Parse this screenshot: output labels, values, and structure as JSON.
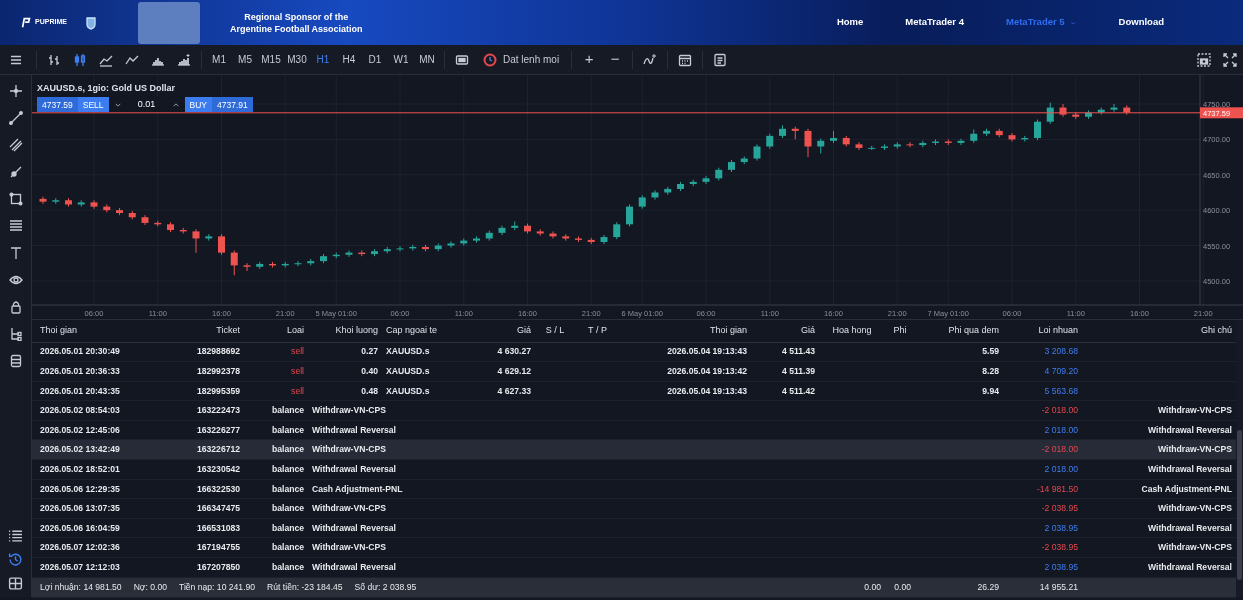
{
  "banner": {
    "logo": "PUPRIME",
    "sponsor_lines": [
      "Regional Sponsor of the",
      "Argentine Football Association"
    ],
    "nav": [
      {
        "label": "Home",
        "selected": false,
        "dropdown": false
      },
      {
        "label": "MetaTrader 4",
        "selected": false,
        "dropdown": false
      },
      {
        "label": "MetaTrader 5",
        "selected": true,
        "dropdown": true
      },
      {
        "label": "Download",
        "selected": false,
        "dropdown": false
      }
    ]
  },
  "toolbar": {
    "chart_types": [
      {
        "kind": "bars",
        "selected": false
      },
      {
        "kind": "candles",
        "selected": true
      },
      {
        "kind": "area",
        "selected": false
      },
      {
        "kind": "line",
        "selected": false
      },
      {
        "kind": "histogram",
        "selected": false
      },
      {
        "kind": "baseline",
        "selected": false
      }
    ],
    "timeframes": [
      {
        "label": "M1",
        "selected": false
      },
      {
        "label": "M5",
        "selected": false
      },
      {
        "label": "M15",
        "selected": false
      },
      {
        "label": "M30",
        "selected": false
      },
      {
        "label": "H1",
        "selected": true
      },
      {
        "label": "H4",
        "selected": false
      },
      {
        "label": "D1",
        "selected": false
      },
      {
        "label": "W1",
        "selected": false
      },
      {
        "label": "MN",
        "selected": false
      }
    ],
    "order_button": "Dat lenh moi",
    "zoom_in": "+",
    "zoom_out": "−"
  },
  "chart": {
    "title": "XAUUSD.s, 1gio: Gold US Dollar",
    "sell_price": "4737.59",
    "sell_label": "SELL",
    "volume": "0.01",
    "buy_label": "BUY",
    "buy_price": "4737.91",
    "chart_data": {
      "type": "candlestick",
      "categories": [
        null,
        null,
        null,
        null,
        "06:00",
        null,
        null,
        null,
        null,
        "11:00",
        null,
        null,
        null,
        null,
        "16:00",
        null,
        null,
        null,
        null,
        "21:00",
        null,
        null,
        null,
        "5 May 01:00",
        null,
        null,
        null,
        null,
        "06:00",
        null,
        null,
        null,
        null,
        "11:00",
        null,
        null,
        null,
        null,
        "16:00",
        null,
        null,
        null,
        null,
        "21:00",
        null,
        null,
        null,
        "6 May 01:00",
        null,
        null,
        null,
        null,
        "06:00",
        null,
        null,
        null,
        null,
        "11:00",
        null,
        null,
        null,
        null,
        "16:00",
        null,
        null,
        null,
        null,
        "21:00",
        null,
        null,
        null,
        "7 May 01:00",
        null,
        null,
        null,
        null,
        "06:00",
        null,
        null,
        null,
        null,
        "11:00",
        null,
        null,
        null,
        null,
        "16:00",
        null,
        null,
        null,
        null,
        "21:00"
      ],
      "ylim": [
        4466,
        4791
      ],
      "grid": true,
      "ref_lines": [
        {
          "axis": "y",
          "value": 4737.59,
          "label": "4737.59",
          "color": "#ef5350"
        }
      ],
      "ohlc": [
        [
          4616,
          4619,
          4609,
          4612
        ],
        [
          4612,
          4617,
          4609,
          4614
        ],
        [
          4614,
          4617,
          4605,
          4608
        ],
        [
          4608,
          4614,
          4605,
          4611
        ],
        [
          4611,
          4614,
          4602,
          4605
        ],
        [
          4605,
          4608,
          4597,
          4600
        ],
        [
          4600,
          4603,
          4593,
          4596
        ],
        [
          4596,
          4599,
          4587,
          4590
        ],
        [
          4590,
          4593,
          4579,
          4582
        ],
        [
          4582,
          4585,
          4577,
          4580
        ],
        [
          4580,
          4583,
          4569,
          4572
        ],
        [
          4572,
          4575,
          4567,
          4570
        ],
        [
          4570,
          4573,
          4540,
          4560
        ],
        [
          4560,
          4566,
          4557,
          4563
        ],
        [
          4563,
          4566,
          4537,
          4540
        ],
        [
          4540,
          4543,
          4508,
          4522
        ],
        [
          4522,
          4525,
          4514,
          4520
        ],
        [
          4520,
          4527,
          4517,
          4524
        ],
        [
          4524,
          4527,
          4519,
          4522
        ],
        [
          4522,
          4527,
          4519,
          4524
        ],
        [
          4524,
          4528,
          4521,
          4525
        ],
        [
          4525,
          4531,
          4522,
          4528
        ],
        [
          4528,
          4538,
          4525,
          4535
        ],
        [
          4535,
          4540,
          4532,
          4537
        ],
        [
          4537,
          4543,
          4534,
          4540
        ],
        [
          4540,
          4543,
          4535,
          4538
        ],
        [
          4538,
          4545,
          4535,
          4542
        ],
        [
          4542,
          4548,
          4539,
          4545
        ],
        [
          4545,
          4549,
          4542,
          4546
        ],
        [
          4546,
          4551,
          4543,
          4548
        ],
        [
          4548,
          4551,
          4542,
          4545
        ],
        [
          4545,
          4553,
          4542,
          4550
        ],
        [
          4550,
          4556,
          4547,
          4553
        ],
        [
          4553,
          4560,
          4550,
          4557
        ],
        [
          4557,
          4563,
          4554,
          4560
        ],
        [
          4560,
          4571,
          4557,
          4568
        ],
        [
          4568,
          4578,
          4565,
          4575
        ],
        [
          4575,
          4584,
          4572,
          4578
        ],
        [
          4578,
          4581,
          4567,
          4570
        ],
        [
          4570,
          4573,
          4564,
          4567
        ],
        [
          4567,
          4570,
          4560,
          4563
        ],
        [
          4563,
          4566,
          4557,
          4560
        ],
        [
          4560,
          4563,
          4555,
          4558
        ],
        [
          4558,
          4561,
          4552,
          4555
        ],
        [
          4555,
          4565,
          4552,
          4562
        ],
        [
          4562,
          4583,
          4559,
          4580
        ],
        [
          4580,
          4608,
          4577,
          4605
        ],
        [
          4605,
          4621,
          4602,
          4618
        ],
        [
          4618,
          4628,
          4615,
          4625
        ],
        [
          4625,
          4633,
          4622,
          4630
        ],
        [
          4630,
          4640,
          4627,
          4637
        ],
        [
          4637,
          4643,
          4634,
          4640
        ],
        [
          4640,
          4648,
          4637,
          4645
        ],
        [
          4645,
          4660,
          4642,
          4657
        ],
        [
          4657,
          4671,
          4654,
          4668
        ],
        [
          4668,
          4676,
          4665,
          4673
        ],
        [
          4673,
          4693,
          4670,
          4690
        ],
        [
          4690,
          4708,
          4687,
          4705
        ],
        [
          4705,
          4720,
          4702,
          4715
        ],
        [
          4715,
          4718,
          4700,
          4712
        ],
        [
          4712,
          4715,
          4675,
          4690
        ],
        [
          4690,
          4701,
          4680,
          4698
        ],
        [
          4698,
          4712,
          4695,
          4702
        ],
        [
          4702,
          4705,
          4690,
          4693
        ],
        [
          4693,
          4696,
          4685,
          4688
        ],
        [
          4688,
          4691,
          4685,
          4688
        ],
        [
          4688,
          4693,
          4685,
          4690
        ],
        [
          4690,
          4696,
          4687,
          4693
        ],
        [
          4693,
          4696,
          4689,
          4692
        ],
        [
          4692,
          4698,
          4689,
          4695
        ],
        [
          4695,
          4700,
          4692,
          4697
        ],
        [
          4697,
          4700,
          4692,
          4695
        ],
        [
          4695,
          4701,
          4692,
          4698
        ],
        [
          4698,
          4714,
          4695,
          4708
        ],
        [
          4708,
          4715,
          4705,
          4712
        ],
        [
          4712,
          4715,
          4703,
          4706
        ],
        [
          4706,
          4709,
          4697,
          4700
        ],
        [
          4700,
          4705,
          4697,
          4702
        ],
        [
          4702,
          4728,
          4699,
          4725
        ],
        [
          4725,
          4752,
          4722,
          4745
        ],
        [
          4745,
          4750,
          4732,
          4735
        ],
        [
          4735,
          4738,
          4729,
          4732
        ],
        [
          4732,
          4741,
          4729,
          4738
        ],
        [
          4738,
          4745,
          4735,
          4742
        ],
        [
          4742,
          4750,
          4739,
          4745
        ],
        [
          4745,
          4748,
          4735,
          4738
        ],
        null,
        null,
        null,
        null,
        null,
        null
      ],
      "yticks": [
        {
          "value": 4750,
          "label": "4750.00"
        },
        {
          "value": 4700,
          "label": "4700.00"
        },
        {
          "value": 4650,
          "label": "4650.00"
        },
        {
          "value": 4600,
          "label": "4600.00"
        },
        {
          "value": 4550,
          "label": "4550.00"
        },
        {
          "value": 4500,
          "label": "4500.00"
        }
      ]
    }
  },
  "sidebar_bottom": [
    {
      "kind": "list",
      "selected": false
    },
    {
      "kind": "history",
      "selected": true
    },
    {
      "kind": "panel",
      "selected": false
    }
  ],
  "table": {
    "columns": [
      "Thoi gian",
      "Ticket",
      "Loai",
      "Khoi luong",
      "Cap ngoai te",
      "Giá",
      "S / L",
      "T / P",
      "Thoi gian",
      "Giá",
      "Hoa hong",
      "Phi",
      "Phi qua dem",
      "Loi nhuan",
      "Ghi chú"
    ],
    "rows": [
      {
        "kind": "trade",
        "time": "2026.05.01 20:30:49",
        "ticket": "182988692",
        "type": "sell",
        "volume": "0.27",
        "symbol": "XAUUSD.s",
        "price": "4 630.27",
        "close_time": "2026.05.04 19:13:43",
        "close_price": "4 511.43",
        "swap": "5.59",
        "profit": "3 208.68",
        "negative": false,
        "selected": false
      },
      {
        "kind": "trade",
        "time": "2026.05.01 20:36:33",
        "ticket": "182992378",
        "type": "sell",
        "volume": "0.40",
        "symbol": "XAUUSD.s",
        "price": "4 629.12",
        "close_time": "2026.05.04 19:13:42",
        "close_price": "4 511.39",
        "swap": "8.28",
        "profit": "4 709.20",
        "negative": false,
        "selected": false
      },
      {
        "kind": "trade",
        "time": "2026.05.01 20:43:35",
        "ticket": "182995359",
        "type": "sell",
        "volume": "0.48",
        "symbol": "XAUUSD.s",
        "price": "4 627.33",
        "close_time": "2026.05.04 19:13:43",
        "close_price": "4 511.42",
        "swap": "9.94",
        "profit": "5 563.68",
        "negative": false,
        "selected": false
      },
      {
        "kind": "balance",
        "time": "2026.05.02 08:54:03",
        "ticket": "163222473",
        "type": "balance",
        "comment": "Withdraw-VN-CPS",
        "profit": "-2 018.00",
        "negative": true,
        "note": "Withdraw-VN-CPS",
        "selected": false
      },
      {
        "kind": "balance",
        "time": "2026.05.02 12:45:06",
        "ticket": "163226277",
        "type": "balance",
        "comment": "Withdrawal Reversal",
        "profit": "2 018.00",
        "negative": false,
        "note": "Withdrawal Reversal",
        "selected": false
      },
      {
        "kind": "balance",
        "time": "2026.05.02 13:42:49",
        "ticket": "163226712",
        "type": "balance",
        "comment": "Withdraw-VN-CPS",
        "profit": "-2 018.00",
        "negative": true,
        "note": "Withdraw-VN-CPS",
        "selected": true
      },
      {
        "kind": "balance",
        "time": "2026.05.02 18:52:01",
        "ticket": "163230542",
        "type": "balance",
        "comment": "Withdrawal Reversal",
        "profit": "2 018.00",
        "negative": false,
        "note": "Withdrawal Reversal",
        "selected": false
      },
      {
        "kind": "balance",
        "time": "2026.05.06 12:29:35",
        "ticket": "166322530",
        "type": "balance",
        "comment": "Cash Adjustment-PNL",
        "profit": "-14 981.50",
        "negative": true,
        "note": "Cash Adjustment-PNL",
        "selected": false
      },
      {
        "kind": "balance",
        "time": "2026.05.06 13:07:35",
        "ticket": "166347475",
        "type": "balance",
        "comment": "Withdraw-VN-CPS",
        "profit": "-2 038.95",
        "negative": true,
        "note": "Withdraw-VN-CPS",
        "selected": false
      },
      {
        "kind": "balance",
        "time": "2026.05.06 16:04:59",
        "ticket": "166531083",
        "type": "balance",
        "comment": "Withdrawal Reversal",
        "profit": "2 038.95",
        "negative": false,
        "note": "Withdrawal Reversal",
        "selected": false
      },
      {
        "kind": "balance",
        "time": "2026.05.07 12:02:36",
        "ticket": "167194755",
        "type": "balance",
        "comment": "Withdraw-VN-CPS",
        "profit": "-2 038.95",
        "negative": true,
        "note": "Withdraw-VN-CPS",
        "selected": false
      },
      {
        "kind": "balance",
        "time": "2026.05.07 12:12:03",
        "ticket": "167207850",
        "type": "balance",
        "comment": "Withdrawal Reversal",
        "profit": "2 038.95",
        "negative": false,
        "note": "Withdrawal Reversal",
        "selected": false
      }
    ]
  },
  "footer": {
    "summary": [
      "Lợi nhuận: 14 981.50",
      "Nợ: 0.00",
      "Tiền nạp: 10 241.90",
      "Rút tiền: -23 184.45",
      "Số dư: 2 038.95"
    ],
    "commission": "0.00",
    "fee": "0.00",
    "swap": "26.29",
    "profit": "14 955.21"
  }
}
